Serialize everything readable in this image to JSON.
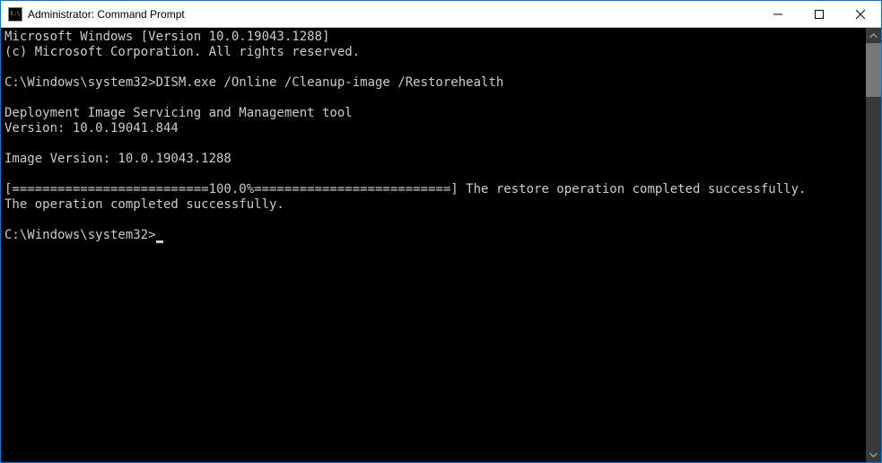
{
  "titlebar": {
    "title": "Administrator: Command Prompt"
  },
  "console": {
    "lines": [
      "Microsoft Windows [Version 10.0.19043.1288]",
      "(c) Microsoft Corporation. All rights reserved.",
      "",
      "C:\\Windows\\system32>DISM.exe /Online /Cleanup-image /Restorehealth",
      "",
      "Deployment Image Servicing and Management tool",
      "Version: 10.0.19041.844",
      "",
      "Image Version: 10.0.19043.1288",
      "",
      "[==========================100.0%==========================] The restore operation completed successfully.",
      "The operation completed successfully.",
      ""
    ],
    "prompt": "C:\\Windows\\system32>"
  }
}
